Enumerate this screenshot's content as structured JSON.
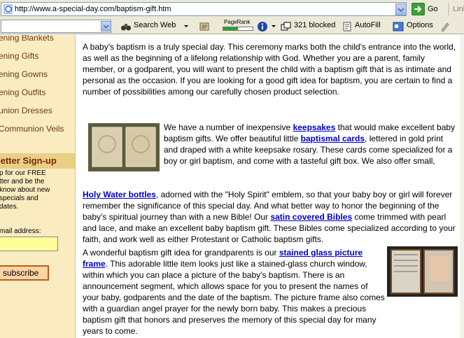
{
  "address_bar": {
    "url": "http://www.a-special-day.com/baptism-gift.htm",
    "go_label": "Go",
    "links_label": "Links"
  },
  "toolbar": {
    "search_web": "Search Web",
    "pagerank_label": "PageRank",
    "pagerank_level": 0.5,
    "blocked": "321 blocked",
    "autofill": "AutoFill",
    "options": "Options"
  },
  "sidebar": {
    "items": [
      {
        "label": "ening Blankets"
      },
      {
        "label": "ening Gifts"
      },
      {
        "label": "ening Gowns"
      },
      {
        "label": "ening Outfits"
      },
      {
        "label": "union Dresses"
      },
      {
        "label": "Communion Veils"
      }
    ],
    "newsletter_heading": "letter Sign-up",
    "newsletter_text": [
      "p for our FREE",
      "tter and be the",
      " know about new",
      " specials and",
      "dates."
    ],
    "email_label": "mail address:",
    "subscribe_label": "subscribe"
  },
  "content": {
    "p1": "A baby's baptism is a truly special day. This ceremony marks both the child's entrance into the world, as well as the beginning of a lifelong relationship with God. Whether you are a parent, family member, or a godparent, you will want to present the child with a baptism gift that is as intimate and personal as the occasion. If you are looking for a good gift idea for baptism, you are certain to find a number of possibilities among our carefully chosen product selection.",
    "p2": {
      "t1": "We have a number of inexpensive ",
      "l1": "keepsakes",
      "t2": " that would make excellent baby baptism gifts. We offer beautiful little ",
      "l2": "baptismal cards",
      "t3": ", lettered in gold print and draped with a white keepsake rosary. These cards come specialized for a boy or girl baptism, and come with a tasteful gift box. We also offer small, ",
      "l3": "Holy Water bottles",
      "t4": ", adorned with the \"Holy Spirit\" emblem, so that your baby boy or girl will forever remember the significance of this special day. And what better way to honor the beginning of the baby's spiritual journey than with a new Bible! Our ",
      "l4": "satin covered Bibles",
      "t5": " come trimmed with pearl and lace, and make an excellent baby baptism gift. These Bibles come specialized according to your faith, and work well as either Protestant or Catholic baptism gifts."
    },
    "p3": {
      "t1": "A wonderful baptism gift idea for grandparents is our ",
      "l1": "stained glass picture frame",
      "t2": ". This adorable little item looks just like a stained-glass church window, within which you can place a picture of the baby's baptism. There is an announcement segment, which allows space for you to present the names of your baby, godparents and the date of the baptism. The picture frame also comes with a guardian angel prayer for the newly born baby. This makes a precious baptism gift that honors and preserves the memory of this special day for many years to come."
    }
  }
}
